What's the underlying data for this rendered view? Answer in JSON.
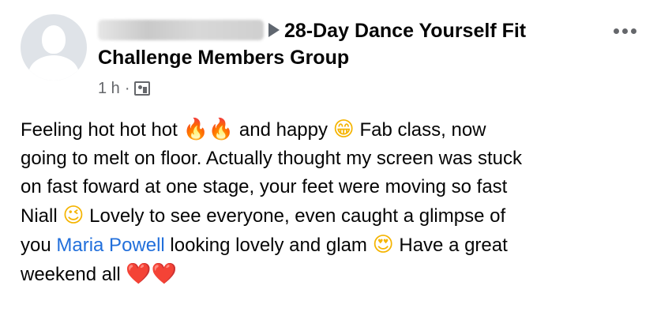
{
  "post": {
    "author_redacted": true,
    "group_name_line1": "28-Day Dance Yourself Fit",
    "group_name_line2": "Challenge Members Group",
    "timestamp": "1 h",
    "separator": "·",
    "audience_icon": "group-audience-icon",
    "more_icon": "more-options-icon"
  },
  "body": {
    "l1a": "Feeling hot hot hot ",
    "l1_fire1": "🔥",
    "l1_fire2": "🔥",
    "l1b": " and happy ",
    "l1_grin": "😁",
    "l1c": " Fab class, now",
    "l2": "going to melt on floor. Actually thought my screen was stuck",
    "l3": "on  fast foward at one stage, your feet were moving so fast",
    "l4a": "Niall ",
    "l4_wink": "😉",
    "l4b": " Lovely to see everyone, even caught a glimpse of",
    "l5a": "you ",
    "l5_mention": "Maria Powell",
    "l5b": " looking lovely and glam ",
    "l5_hearteyes": "😍",
    "l5c": " Have a great",
    "l6a": "weekend all ",
    "l6_heart1": "❤️",
    "l6_heart2": "❤️"
  },
  "colors": {
    "mention": "#216fdb",
    "secondary_text": "#65676b",
    "primary_text": "#050505"
  }
}
